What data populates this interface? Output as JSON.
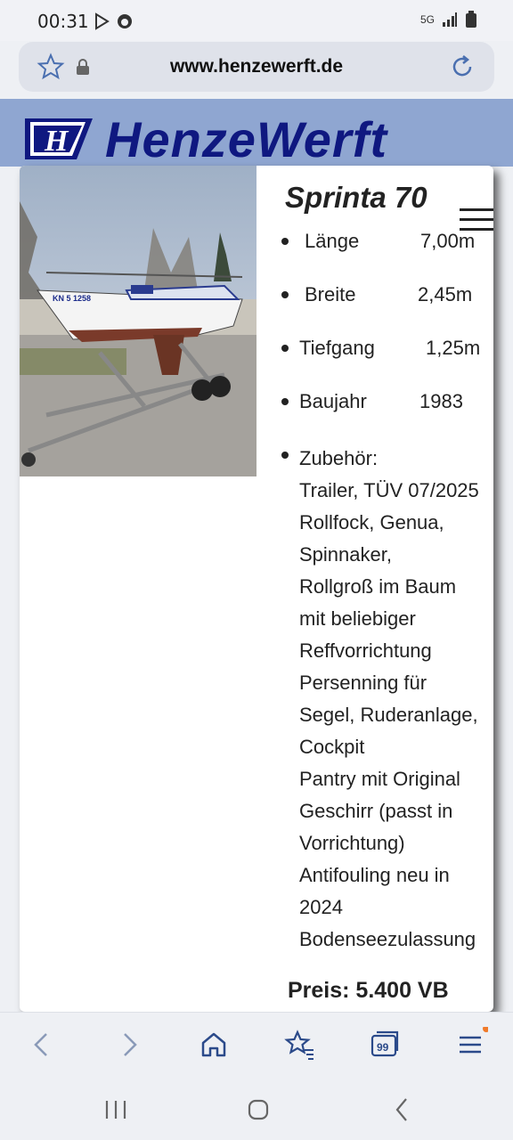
{
  "status_bar": {
    "time": "00:31",
    "network": "5G",
    "icons": [
      "play-store-icon",
      "sync-icon",
      "network-5g-icon",
      "signal-icon",
      "battery-icon"
    ]
  },
  "browser": {
    "url": "www.henzewerft.de",
    "icons": [
      "bookmark-star-icon",
      "lock-icon",
      "reload-icon"
    ]
  },
  "site": {
    "brand": "HenzeWerft",
    "logo_letter": "H",
    "colors": {
      "banner": "#8fa6d1",
      "brand": "#0f1880"
    }
  },
  "listing": {
    "photo_label": "KN 5 1258",
    "title": "Sprinta 70",
    "specs": [
      {
        "label": "Länge",
        "value": "7,00m"
      },
      {
        "label": "Breite",
        "value": "2,45m"
      },
      {
        "label": "Tiefgang",
        "value": "1,25m"
      },
      {
        "label": "Baujahr",
        "value": "1983"
      }
    ],
    "accessories_heading": "Zubehör:",
    "accessories": [
      "Trailer, TÜV 07/2025",
      "Rollfock, Genua,",
      "Spinnaker,",
      "Rollgroß im Baum",
      "mit beliebiger",
      "Reffvorrichtung",
      "Persenning für",
      "Segel, Ruderanlage,",
      "Cockpit",
      "Pantry mit Original",
      "Geschirr (passt in",
      "Vorrichtung)",
      "Antifouling neu in",
      "2024",
      "Bodenseezulassung"
    ],
    "price": "Preis: 5.400 VB"
  },
  "bottom_nav": {
    "icons": [
      "back-icon",
      "forward-icon",
      "home-icon",
      "bookmarks-icon",
      "tabs-icon",
      "menu-icon"
    ],
    "tabs_count": "99"
  },
  "system_nav": {
    "icons": [
      "recents-icon",
      "home-circle-icon",
      "system-back-icon"
    ]
  }
}
